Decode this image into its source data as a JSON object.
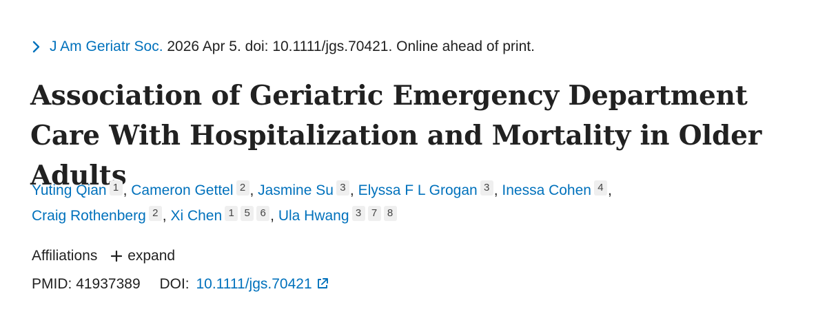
{
  "citation": {
    "journal": "J Am Geriatr Soc.",
    "details": " 2026 Apr 5. doi: 10.1111/jgs.70421. Online ahead of print."
  },
  "title": "Association of Geriatric Emergency Department Care With Hospitalization and Mortality in Older Adults",
  "authors": {
    "line1": [
      {
        "name": "Yuting Qian",
        "affiliations": [
          "1"
        ]
      },
      {
        "name": "Cameron Gettel",
        "affiliations": [
          "2"
        ]
      },
      {
        "name": "Jasmine Su",
        "affiliations": [
          "3"
        ]
      },
      {
        "name": "Elyssa F L Grogan",
        "affiliations": [
          "3"
        ]
      },
      {
        "name": "Inessa Cohen",
        "affiliations": [
          "4"
        ]
      }
    ],
    "line2": [
      {
        "name": "Craig Rothenberg",
        "affiliations": [
          "2"
        ]
      },
      {
        "name": "Xi Chen",
        "affiliations": [
          "1",
          "5",
          "6"
        ]
      },
      {
        "name": "Ula Hwang",
        "affiliations": [
          "3",
          "7",
          "8"
        ]
      }
    ]
  },
  "affiliations": {
    "label": "Affiliations",
    "expand_label": "expand"
  },
  "identifiers": {
    "pmid_label": "PMID:",
    "pmid": "41937389",
    "doi_label": "DOI:",
    "doi": "10.1111/jgs.70421"
  },
  "icons": {
    "citation_toggle": "chevron-right-icon",
    "expand": "plus-icon",
    "external_link": "external-link-icon"
  },
  "colors": {
    "link": "#0071bc",
    "text": "#212121",
    "badge_bg": "#efefef"
  }
}
